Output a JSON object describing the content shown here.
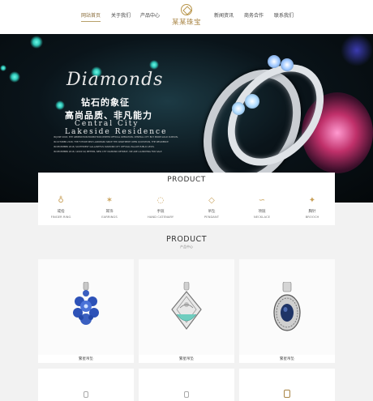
{
  "header": {
    "nav_left": [
      "网站首页",
      "关于我们",
      "产品中心"
    ],
    "nav_right": [
      "新闻资讯",
      "商务合作",
      "联系我们"
    ],
    "logo_text": "某某珠宝"
  },
  "banner": {
    "heading": "Diamonds",
    "slogan1": "钻石的象征",
    "slogan2": "高尚品质、非凡能力",
    "city_line1": "Central City",
    "city_line2": "Lakeside Residence",
    "small_text": [
      "IN JUNE 2018, 8TH GENERATION PROMOTION CENTER OFFICIAL OPERATION, CENTRAL CITY BUY MORE GOLD CURTAIN,",
      "IN OCTOBER 2018, THE FUTURE NEW LANDMARK SINCE THE APARTMENT OPEN QUOTATION, THE RESIDENCE",
      "IN DECEMBER 2018, SOUTHWEST GALLANTHUS DIAMOND CITY OFFICIAL PALACE PUBLIC LEVEL",
      "IN DECEMBER 2018, 12000 SQ METERS, NEW CITY DIAMOND RETREAT, WE ARE LAUNCHING FOR SALE"
    ]
  },
  "categories": {
    "title": "PRODUCT",
    "items": [
      {
        "cn": "戒指",
        "en": "FINGER RING",
        "icon": "ring-icon",
        "glyph": "♁"
      },
      {
        "cn": "耳饰",
        "en": "EARRINGS",
        "icon": "earring-icon",
        "glyph": "✶"
      },
      {
        "cn": "手链",
        "en": "HAND CATENARY",
        "icon": "bracelet-icon",
        "glyph": "◌"
      },
      {
        "cn": "吊坠",
        "en": "PENDANT",
        "icon": "pendant-icon",
        "glyph": "◇"
      },
      {
        "cn": "项链",
        "en": "NECKLACE",
        "icon": "necklace-icon",
        "glyph": "∽"
      },
      {
        "cn": "胸针",
        "en": "BROOCH",
        "icon": "brooch-icon",
        "glyph": "✦"
      }
    ]
  },
  "products_section": {
    "title": "PRODUCT",
    "subtitle": "产品中心",
    "items": [
      {
        "label": "繁星吊坠"
      },
      {
        "label": "繁星吊坠"
      },
      {
        "label": "繁星吊坠"
      }
    ]
  },
  "colors": {
    "accent_gold": "#b8954a",
    "banner_teal": "#2fc7b8",
    "page_bg": "#f2f2f2"
  }
}
